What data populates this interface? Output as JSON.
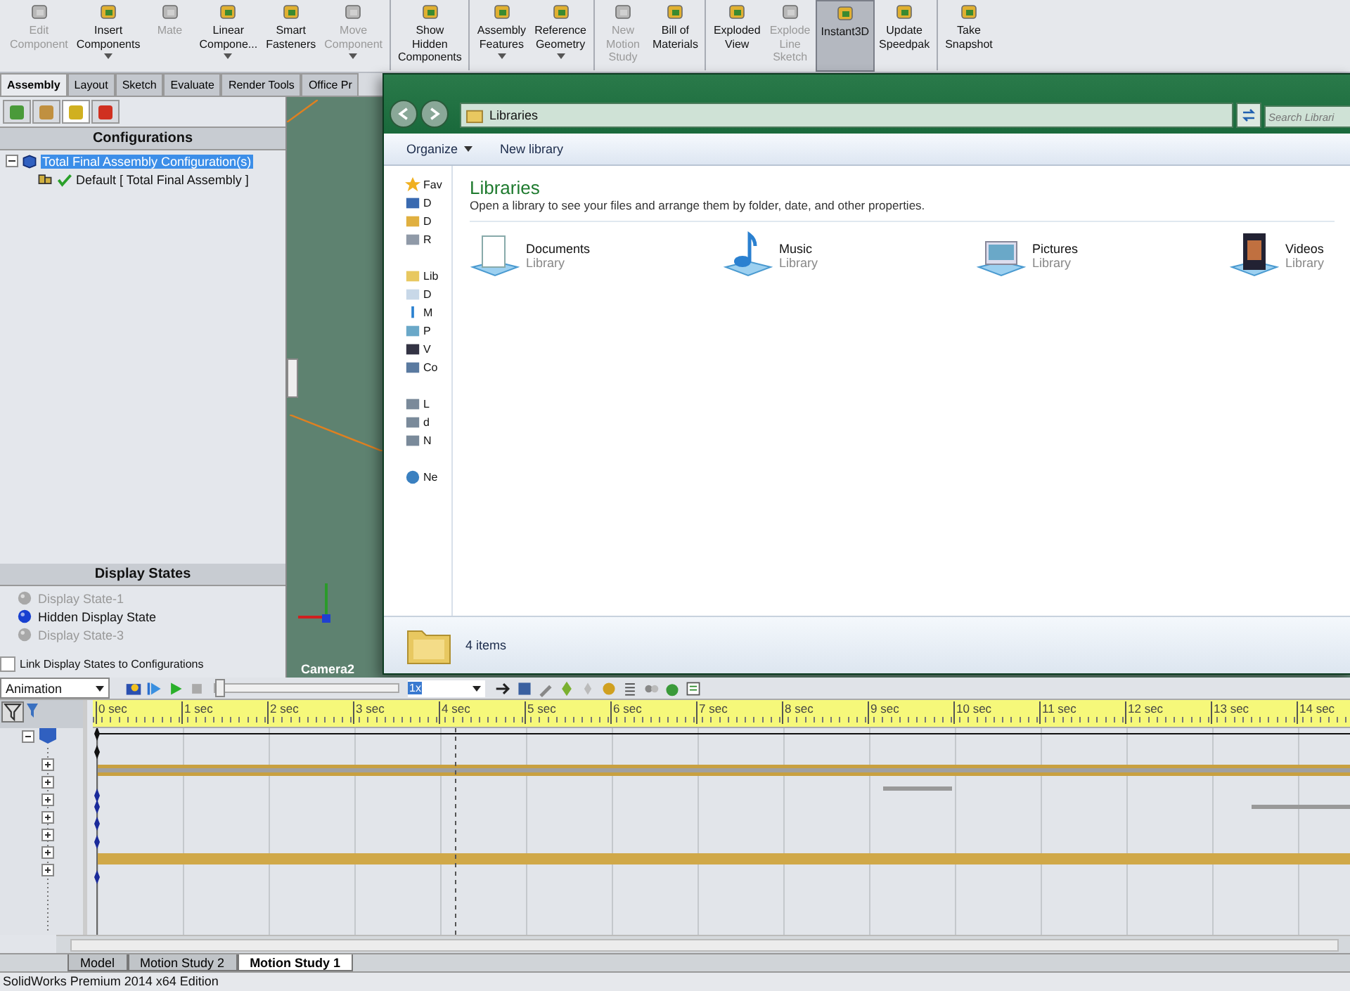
{
  "toolbar": {
    "groups": [
      [
        {
          "lines": [
            "Edit",
            "Component"
          ],
          "disabled": true,
          "dropdown": false,
          "selected": false
        },
        {
          "lines": [
            "Insert",
            "Components"
          ],
          "disabled": false,
          "dropdown": true,
          "selected": false
        },
        {
          "lines": [
            "Mate"
          ],
          "disabled": true,
          "dropdown": false,
          "selected": false
        },
        {
          "lines": [
            "Linear",
            "Compone..."
          ],
          "disabled": false,
          "dropdown": true,
          "selected": false
        },
        {
          "lines": [
            "Smart",
            "Fasteners"
          ],
          "disabled": false,
          "dropdown": false,
          "selected": false
        },
        {
          "lines": [
            "Move",
            "Component"
          ],
          "disabled": true,
          "dropdown": true,
          "selected": false
        }
      ],
      [
        {
          "lines": [
            "Show",
            "Hidden",
            "Components"
          ],
          "disabled": false,
          "dropdown": false,
          "selected": false
        }
      ],
      [
        {
          "lines": [
            "Assembly",
            "Features"
          ],
          "disabled": false,
          "dropdown": true,
          "selected": false
        },
        {
          "lines": [
            "Reference",
            "Geometry"
          ],
          "disabled": false,
          "dropdown": true,
          "selected": false
        }
      ],
      [
        {
          "lines": [
            "New",
            "Motion",
            "Study"
          ],
          "disabled": true,
          "dropdown": false,
          "selected": false
        },
        {
          "lines": [
            "Bill of",
            "Materials"
          ],
          "disabled": false,
          "dropdown": false,
          "selected": false
        }
      ],
      [
        {
          "lines": [
            "Exploded",
            "View"
          ],
          "disabled": false,
          "dropdown": false,
          "selected": false
        },
        {
          "lines": [
            "Explode",
            "Line",
            "Sketch"
          ],
          "disabled": true,
          "dropdown": false,
          "selected": false
        },
        {
          "lines": [
            "Instant3D"
          ],
          "disabled": false,
          "dropdown": false,
          "selected": true
        },
        {
          "lines": [
            "Update",
            "Speedpak"
          ],
          "disabled": false,
          "dropdown": false,
          "selected": false
        }
      ],
      [
        {
          "lines": [
            "Take",
            "Snapshot"
          ],
          "disabled": false,
          "dropdown": false,
          "selected": false
        }
      ]
    ]
  },
  "tabs": [
    {
      "label": "Assembly",
      "selected": true
    },
    {
      "label": "Layout",
      "selected": false
    },
    {
      "label": "Sketch",
      "selected": false
    },
    {
      "label": "Evaluate",
      "selected": false
    },
    {
      "label": "Render Tools",
      "selected": false
    },
    {
      "label": "Office Pr",
      "selected": false
    }
  ],
  "panel": {
    "tabs": [
      {
        "selected": false
      },
      {
        "selected": false
      },
      {
        "selected": true
      },
      {
        "selected": false
      }
    ],
    "configurations": {
      "title": "Configurations",
      "root": {
        "label": "Total Final Assembly Configuration(s)",
        "selected": true,
        "expanded": true,
        "children": [
          {
            "label": "Default [ Total Final Assembly ]",
            "active": true
          }
        ]
      }
    },
    "display_states": {
      "title": "Display States",
      "items": [
        {
          "label": "Display State-1",
          "active": false
        },
        {
          "label": "Hidden Display State",
          "active": true
        },
        {
          "label": "Display State-3",
          "active": false
        }
      ]
    },
    "link_checkbox": {
      "label": "Link Display States to Configurations",
      "checked": false
    }
  },
  "viewport": {
    "camera": "Camera2"
  },
  "explorer": {
    "address": "Libraries",
    "search": {
      "placeholder": "Search Librari"
    },
    "commands": [
      {
        "label": "Organize",
        "dropdown": true
      },
      {
        "label": "New library",
        "dropdown": false
      }
    ],
    "nav": [
      {
        "label": "Fav",
        "kind": "star"
      },
      {
        "label": "D",
        "kind": "desktop"
      },
      {
        "label": "D",
        "kind": "downloads"
      },
      {
        "label": "R",
        "kind": "recent"
      },
      {
        "label": "Lib",
        "kind": "library"
      },
      {
        "label": "D",
        "kind": "doc"
      },
      {
        "label": "M",
        "kind": "music"
      },
      {
        "label": "P",
        "kind": "picture"
      },
      {
        "label": "V",
        "kind": "video"
      },
      {
        "label": "Co",
        "kind": "computer"
      },
      {
        "label": "L",
        "kind": "drive"
      },
      {
        "label": "d",
        "kind": "drive"
      },
      {
        "label": "N",
        "kind": "drive"
      },
      {
        "label": "Ne",
        "kind": "network"
      }
    ],
    "heading": "Libraries",
    "description": "Open a library to see your files and arrange them by folder, date, and other properties.",
    "libraries": [
      {
        "name": "Documents",
        "type": "Library",
        "kind": "doc"
      },
      {
        "name": "Music",
        "type": "Library",
        "kind": "music"
      },
      {
        "name": "Pictures",
        "type": "Library",
        "kind": "picture"
      },
      {
        "name": "Videos",
        "type": "Library",
        "kind": "video"
      }
    ],
    "status": "4 items"
  },
  "timeline": {
    "study_type": "Animation",
    "playback": {
      "level": 0
    },
    "speed": "1x",
    "ruler": [
      "0 sec",
      "1 sec",
      "2 sec",
      "3 sec",
      "4 sec",
      "5 sec",
      "6 sec",
      "7 sec",
      "8 sec",
      "9 sec",
      "10 sec",
      "11 sec",
      "12 sec",
      "13 sec",
      "14 sec"
    ]
  },
  "study_tabs": [
    {
      "label": "Model",
      "selected": false
    },
    {
      "label": "Motion Study 2",
      "selected": false
    },
    {
      "label": "Motion Study 1",
      "selected": true
    }
  ],
  "status_bar": "SolidWorks Premium 2014 x64 Edition"
}
